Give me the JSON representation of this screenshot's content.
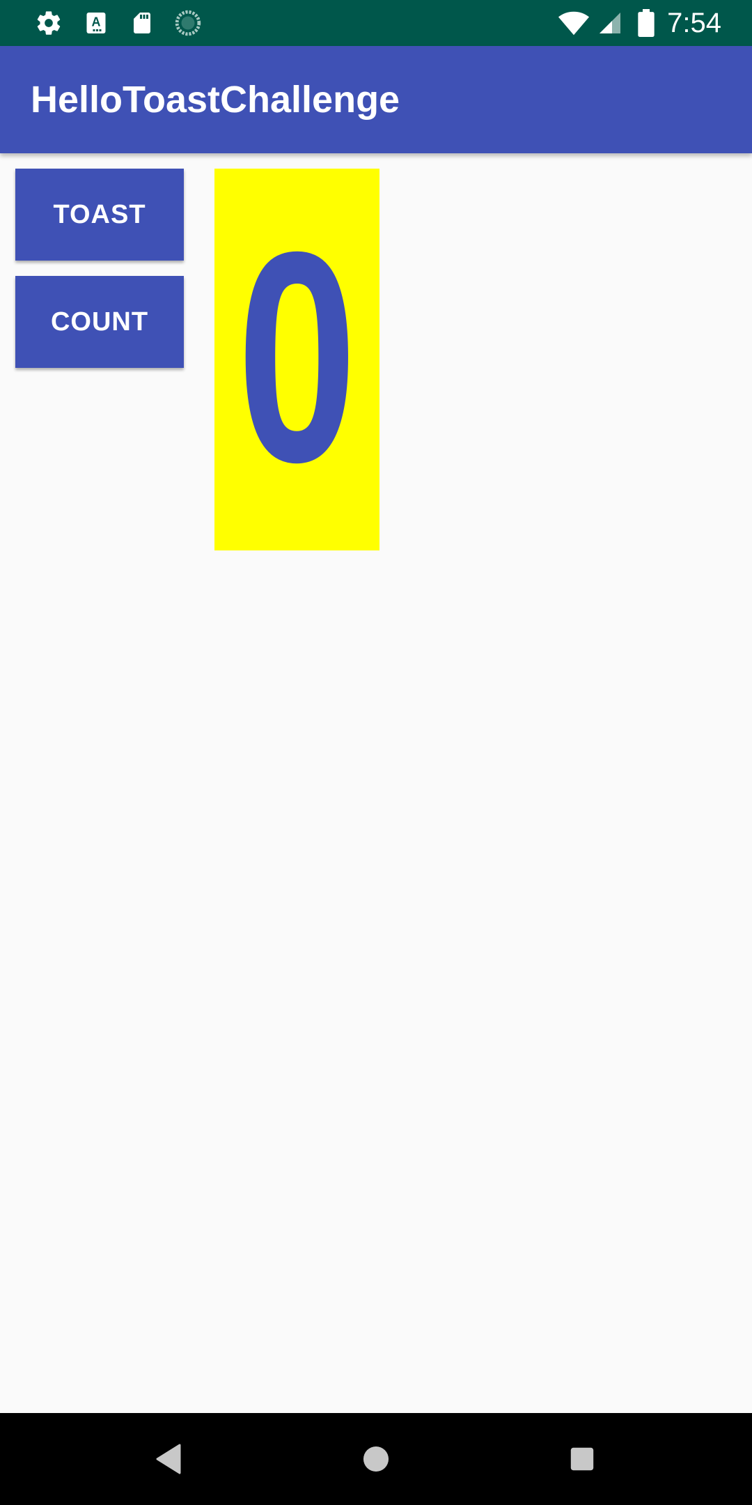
{
  "status_bar": {
    "time": "7:54",
    "left_icons": [
      "gear-icon",
      "font-a-icon",
      "sd-card-icon",
      "sync-icon"
    ],
    "right_icons": [
      "wifi-icon",
      "cell-signal-icon",
      "battery-icon"
    ],
    "background_color": "#00574b"
  },
  "app_bar": {
    "title": "HelloToastChallenge",
    "background_color": "#3f51b5"
  },
  "main": {
    "toast_button_label": "TOAST",
    "count_button_label": "COUNT",
    "count_value": "0",
    "count_background_color": "#ffff00",
    "count_text_color": "#3f51b5"
  },
  "nav_bar": {
    "buttons": [
      "back-icon",
      "home-icon",
      "recents-icon"
    ]
  }
}
